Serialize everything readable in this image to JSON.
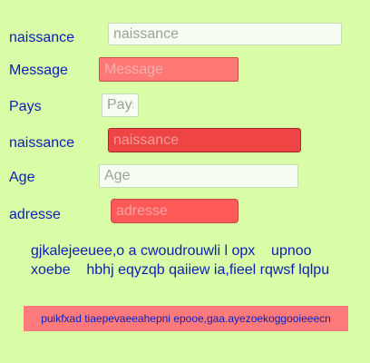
{
  "form": {
    "fields": [
      {
        "label": "naissance",
        "placeholder": "naissance"
      },
      {
        "label": "Message",
        "placeholder": "Message"
      },
      {
        "label": "Pays",
        "placeholder": "Pays"
      },
      {
        "label": "naissance",
        "placeholder": "naissance"
      },
      {
        "label": "Age",
        "placeholder": "Age"
      },
      {
        "label": "adresse",
        "placeholder": "adresse"
      }
    ]
  },
  "text": {
    "line1": "gjkalejeeuee,o a cwoudrouwli l opx    upnoo",
    "line2": "xoebe    hbhj eqyzqb qaiiew ia,fieel rqwsf lqlpu"
  },
  "banner": {
    "text": "puikfxad tiaepevaeeahepni epooe,gaa.ayezoekoggooieeecn"
  },
  "colors": {
    "background": "#d9fca6",
    "text": "#0b1fb6",
    "field_light": "#f6fdf1",
    "field_pink": "#ff7876",
    "field_red": "#ee4443",
    "field_coral": "#ff5a58",
    "banner": "#ff7b7b"
  }
}
